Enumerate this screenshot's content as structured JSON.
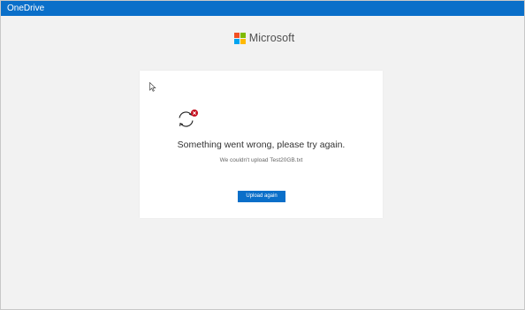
{
  "window": {
    "title": "OneDrive"
  },
  "brand": {
    "name": "Microsoft",
    "logo_colors": [
      "#f25022",
      "#7fba00",
      "#00a4ef",
      "#ffb900"
    ]
  },
  "dialog": {
    "icon": "sync-error-icon",
    "message": "Something went wrong, please try again.",
    "detail": "We couldn't upload Test20GB.txt",
    "button_label": "Upload again"
  },
  "colors": {
    "accent": "#0a6fc9",
    "error": "#c50f1f",
    "background": "#f2f2f2",
    "card": "#ffffff"
  }
}
